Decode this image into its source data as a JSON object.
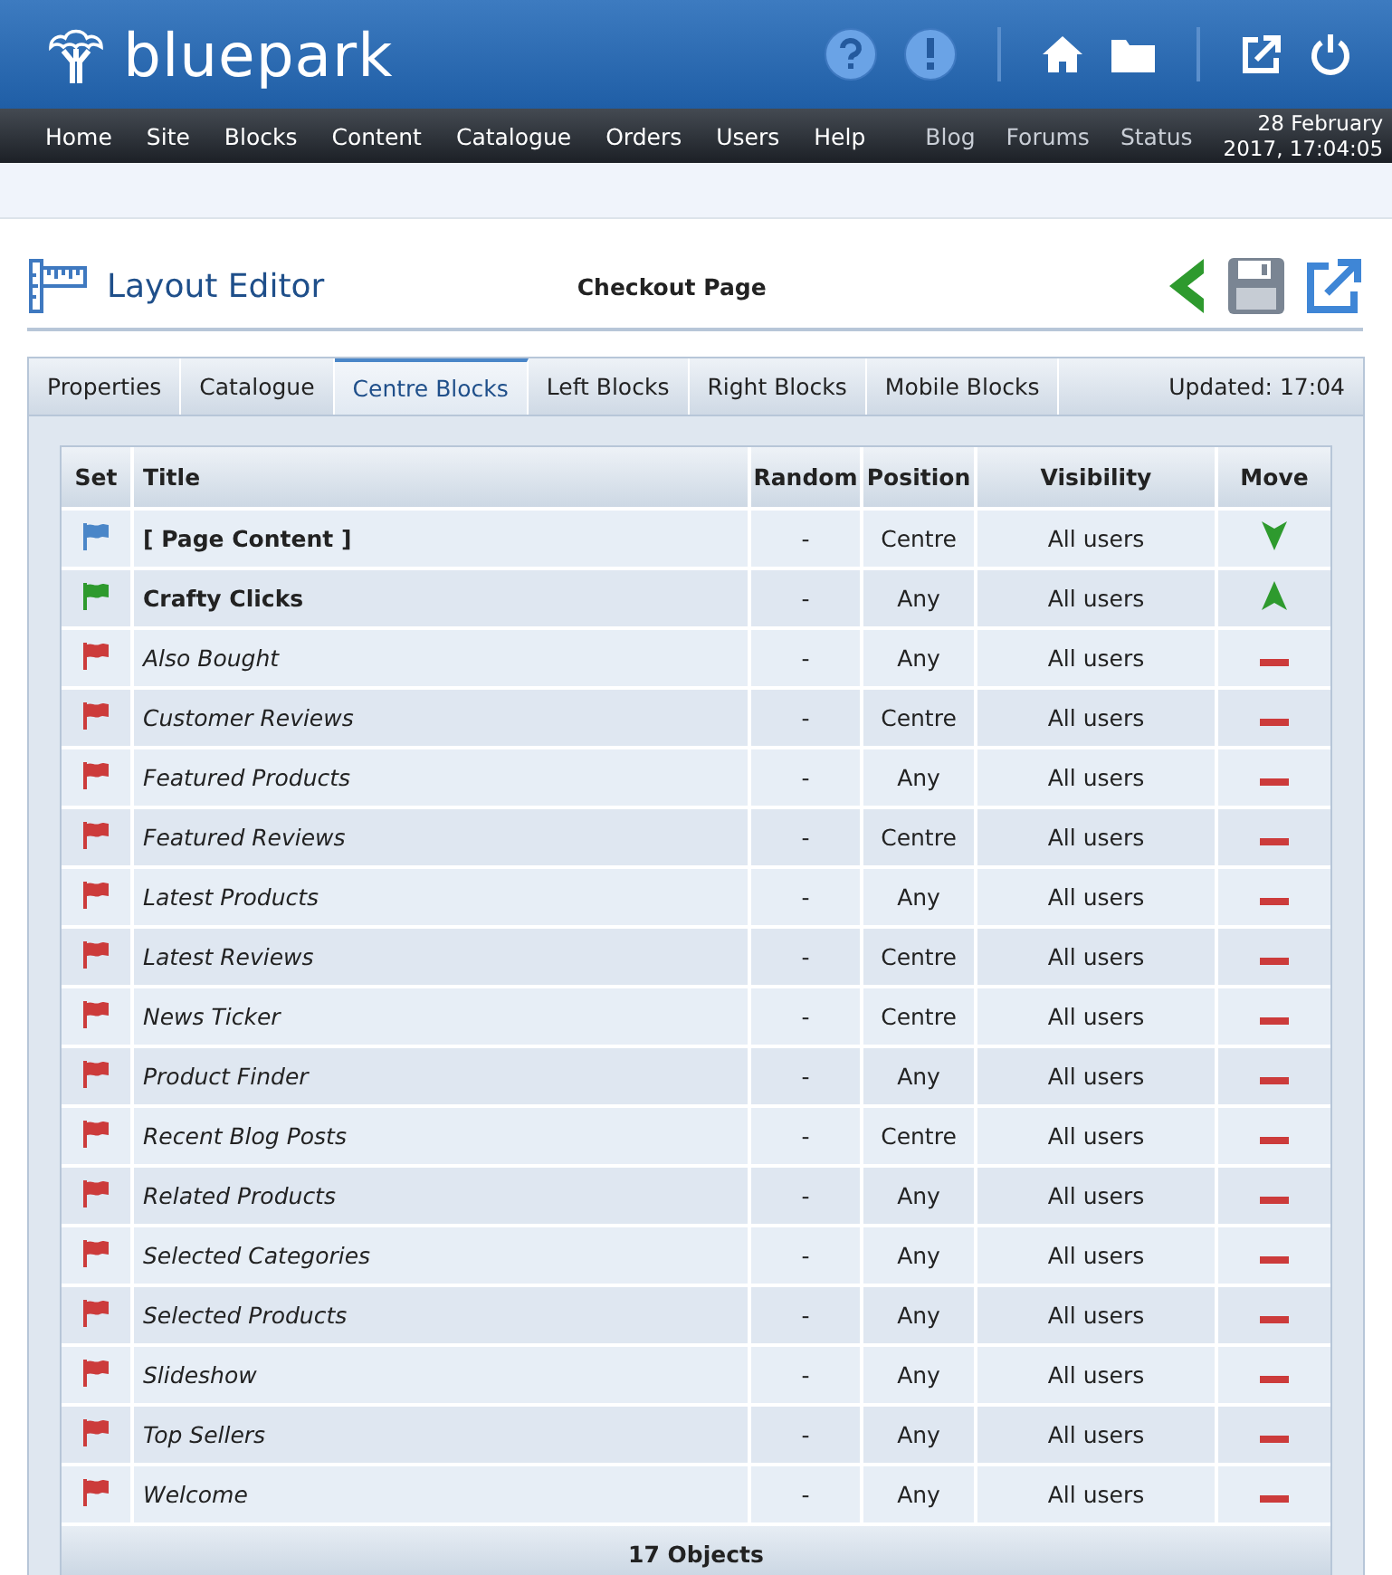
{
  "brand": {
    "name": "bluepark"
  },
  "top_icons": [
    {
      "kind": "help"
    },
    {
      "kind": "alert"
    },
    {
      "kind": "sep"
    },
    {
      "kind": "home"
    },
    {
      "kind": "folder"
    },
    {
      "kind": "sep"
    },
    {
      "kind": "external"
    },
    {
      "kind": "power"
    }
  ],
  "nav": {
    "main": [
      "Home",
      "Site",
      "Blocks",
      "Content",
      "Catalogue",
      "Orders",
      "Users",
      "Help"
    ],
    "secondary": [
      "Blog",
      "Forums",
      "Status"
    ],
    "datetime": [
      "28 February",
      "2017, 17:04:05"
    ]
  },
  "page": {
    "title": "Layout Editor",
    "subtitle": "Checkout Page"
  },
  "tabs": [
    {
      "label": "Properties",
      "selected": false
    },
    {
      "label": "Catalogue",
      "selected": false
    },
    {
      "label": "Centre Blocks",
      "selected": true
    },
    {
      "label": "Left Blocks",
      "selected": false
    },
    {
      "label": "Right Blocks",
      "selected": false
    },
    {
      "label": "Mobile Blocks",
      "selected": false
    }
  ],
  "updated": "Updated: 17:04",
  "table": {
    "columns": [
      "Set",
      "Title",
      "Random",
      "Position",
      "Visibility",
      "Move"
    ],
    "rows": [
      {
        "kind": "content",
        "title": "[ Page Content ]",
        "random": "-",
        "position": "Centre",
        "visibility": "All users"
      },
      {
        "kind": "set",
        "title": "Crafty Clicks",
        "random": "-",
        "position": "Any",
        "visibility": "All users"
      },
      {
        "kind": "unset",
        "title": "Also Bought",
        "random": "-",
        "position": "Any",
        "visibility": "All users"
      },
      {
        "kind": "unset",
        "title": "Customer Reviews",
        "random": "-",
        "position": "Centre",
        "visibility": "All users"
      },
      {
        "kind": "unset",
        "title": "Featured Products",
        "random": "-",
        "position": "Any",
        "visibility": "All users"
      },
      {
        "kind": "unset",
        "title": "Featured Reviews",
        "random": "-",
        "position": "Centre",
        "visibility": "All users"
      },
      {
        "kind": "unset",
        "title": "Latest Products",
        "random": "-",
        "position": "Any",
        "visibility": "All users"
      },
      {
        "kind": "unset",
        "title": "Latest Reviews",
        "random": "-",
        "position": "Centre",
        "visibility": "All users"
      },
      {
        "kind": "unset",
        "title": "News Ticker",
        "random": "-",
        "position": "Centre",
        "visibility": "All users"
      },
      {
        "kind": "unset",
        "title": "Product Finder",
        "random": "-",
        "position": "Any",
        "visibility": "All users"
      },
      {
        "kind": "unset",
        "title": "Recent Blog Posts",
        "random": "-",
        "position": "Centre",
        "visibility": "All users"
      },
      {
        "kind": "unset",
        "title": "Related Products",
        "random": "-",
        "position": "Any",
        "visibility": "All users"
      },
      {
        "kind": "unset",
        "title": "Selected Categories",
        "random": "-",
        "position": "Any",
        "visibility": "All users"
      },
      {
        "kind": "unset",
        "title": "Selected Products",
        "random": "-",
        "position": "Any",
        "visibility": "All users"
      },
      {
        "kind": "unset",
        "title": "Slideshow",
        "random": "-",
        "position": "Any",
        "visibility": "All users"
      },
      {
        "kind": "unset",
        "title": "Top Sellers",
        "random": "-",
        "position": "Any",
        "visibility": "All users"
      },
      {
        "kind": "unset",
        "title": "Welcome",
        "random": "-",
        "position": "Any",
        "visibility": "All users"
      }
    ],
    "footer": "17 Objects"
  }
}
